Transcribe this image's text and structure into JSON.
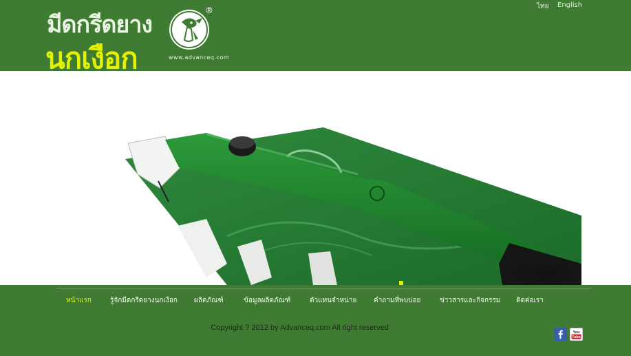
{
  "header": {
    "brand_line1": "มีดกรีดยาง",
    "brand_line2": "นกเงือก",
    "logo_url": "www.advanceq.com",
    "registered_mark": "®",
    "languages": [
      "ไทย",
      "English"
    ]
  },
  "nav": {
    "items": [
      "หน้าแรก",
      "รู้จักมีดกรีดยางนกเงือก",
      "ผลิตภัณฑ์",
      "ข้อมูลผลิตภัณฑ์",
      "ตัวแทนจำหน่าย",
      "คำถามที่พบบ่อย",
      "ข่าวสารและกิจกรรม",
      "ติดต่อเรา"
    ],
    "active_index": 0
  },
  "footer": {
    "copyright": "Copyright ? 2012 by Advanceq.com All right reserved"
  },
  "social": {
    "facebook_icon": "facebook-icon",
    "youtube_icon": "youtube-icon",
    "youtube_text": "You Tube"
  },
  "colors": {
    "brand_green": "#3f7b33",
    "highlight_yellow": "#e3f000",
    "product_green": "#1f7a2c"
  }
}
